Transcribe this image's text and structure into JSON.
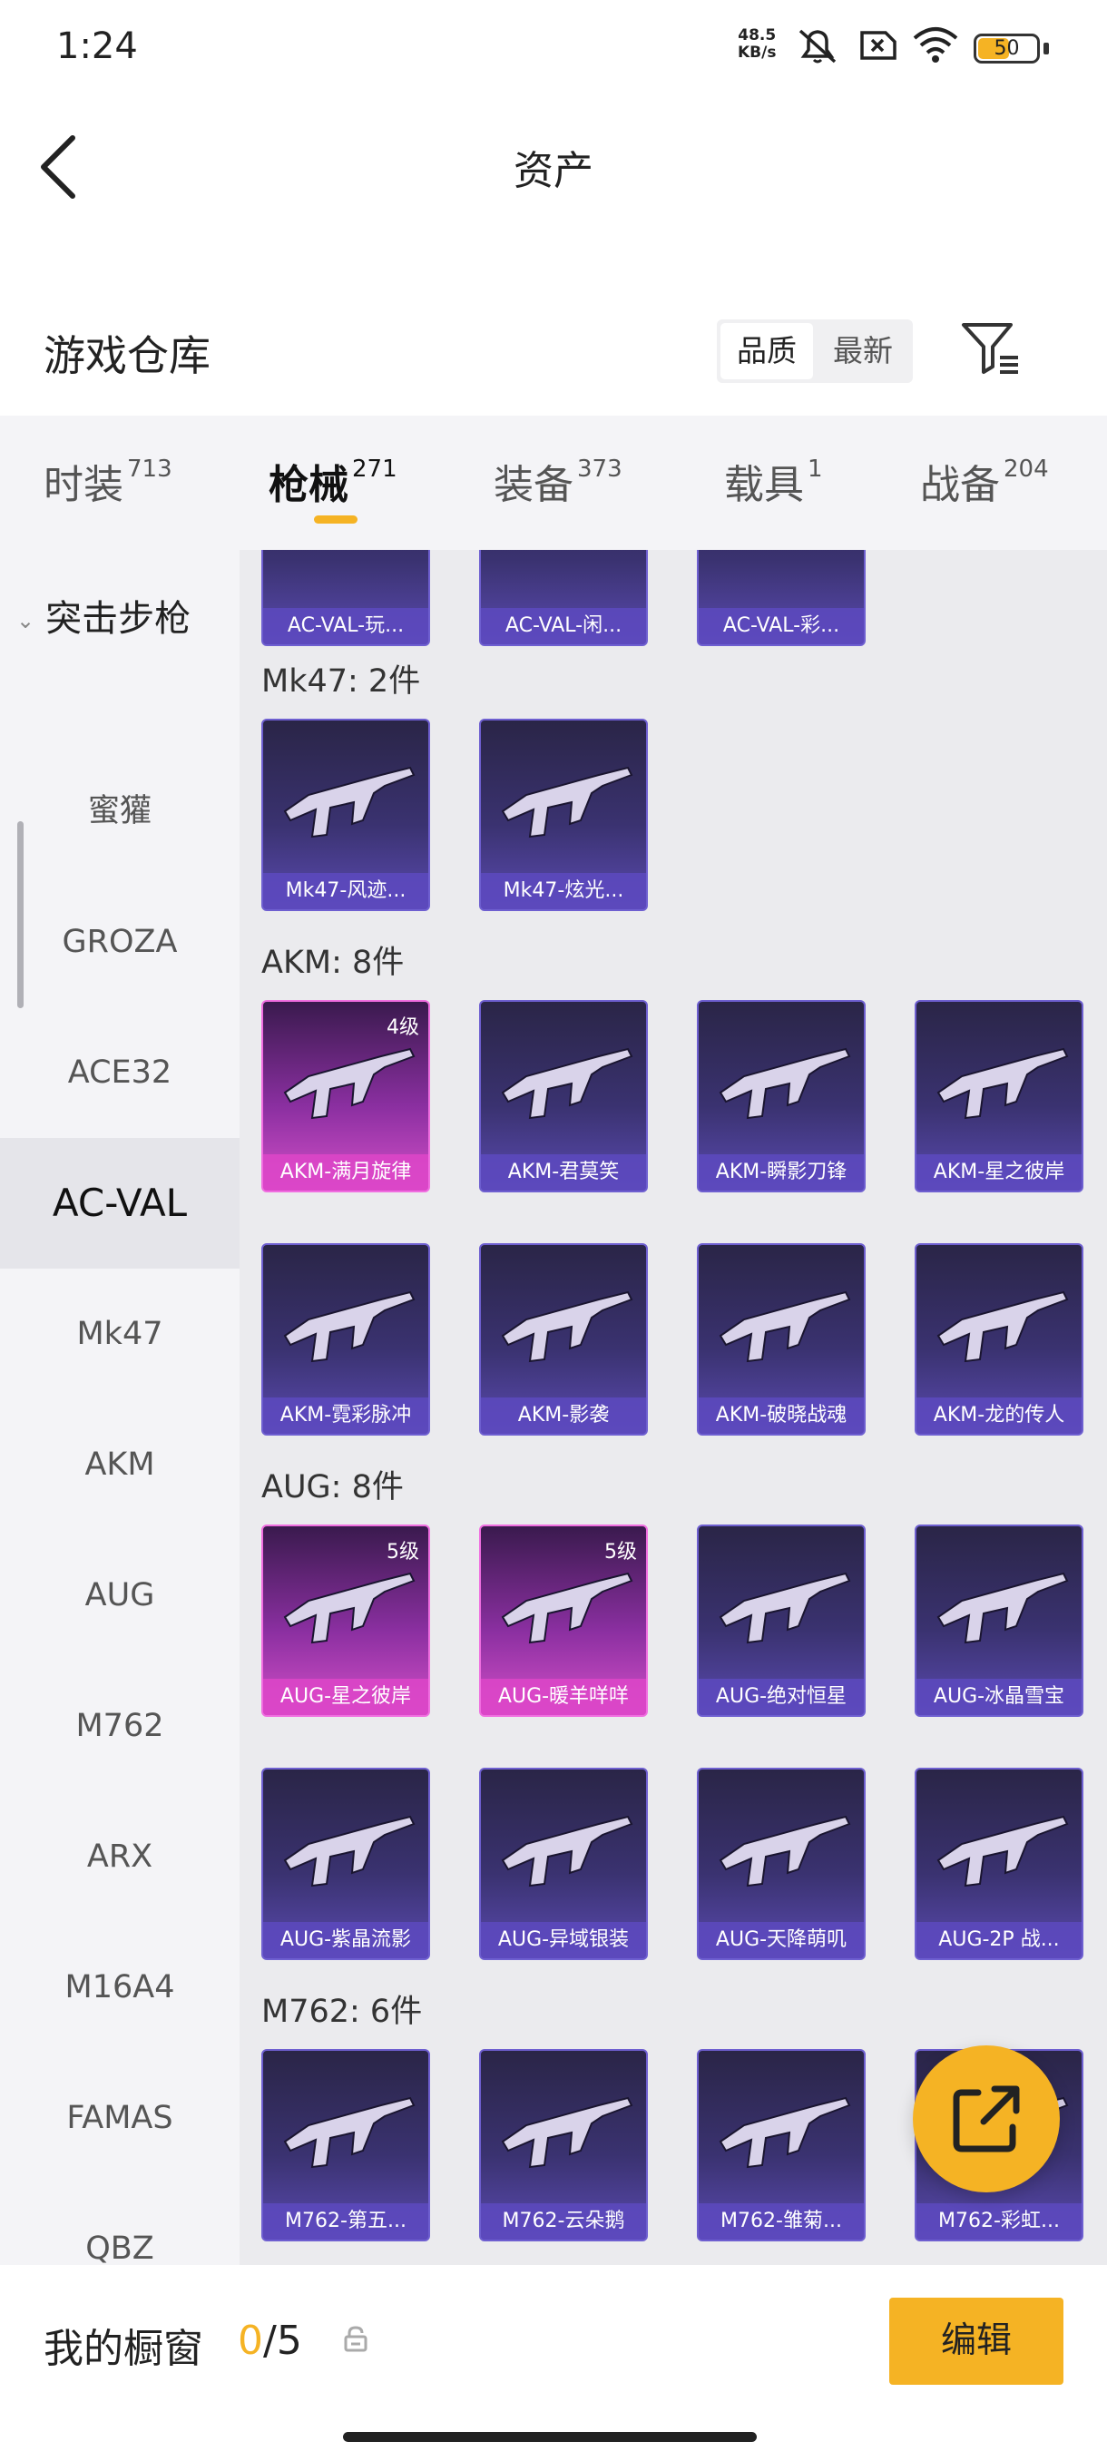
{
  "status": {
    "time": "1:24",
    "netspeed_value": "48.5",
    "netspeed_unit": "KB/s",
    "battery": "50"
  },
  "header": {
    "title": "资产"
  },
  "warehouse": {
    "title": "游戏仓库",
    "sort_quality": "品质",
    "sort_newest": "最新"
  },
  "tabs": [
    {
      "label": "时装",
      "count": "713"
    },
    {
      "label": "枪械",
      "count": "271"
    },
    {
      "label": "装备",
      "count": "373"
    },
    {
      "label": "载具",
      "count": "1"
    },
    {
      "label": "战备",
      "count": "204"
    }
  ],
  "sidebar": {
    "section": "突击步枪",
    "items": [
      "蜜獾",
      "GROZA",
      "ACE32",
      "AC-VAL",
      "Mk47",
      "AKM",
      "AUG",
      "M762",
      "ARX",
      "M16A4",
      "FAMAS",
      "QBZ"
    ],
    "active": "AC-VAL"
  },
  "groups": {
    "acval": {
      "items": [
        {
          "name": "AC-VAL-玩..."
        },
        {
          "name": "AC-VAL-闲..."
        },
        {
          "name": "AC-VAL-彩..."
        }
      ]
    },
    "mk47": {
      "header": "Mk47: 2件",
      "items": [
        {
          "name": "Mk47-风迹..."
        },
        {
          "name": "Mk47-炫光..."
        }
      ]
    },
    "akm": {
      "header": "AKM: 8件",
      "items": [
        {
          "name": "AKM-满月旋律",
          "level": "4级"
        },
        {
          "name": "AKM-君莫笑"
        },
        {
          "name": "AKM-瞬影刀锋"
        },
        {
          "name": "AKM-星之彼岸"
        },
        {
          "name": "AKM-霓彩脉冲"
        },
        {
          "name": "AKM-影袭"
        },
        {
          "name": "AKM-破晓战魂"
        },
        {
          "name": "AKM-龙的传人"
        }
      ]
    },
    "aug": {
      "header": "AUG: 8件",
      "items": [
        {
          "name": "AUG-星之彼岸",
          "level": "5级"
        },
        {
          "name": "AUG-暖羊咩咩",
          "level": "5级"
        },
        {
          "name": "AUG-绝对恒星"
        },
        {
          "name": "AUG-冰晶雪宝"
        },
        {
          "name": "AUG-紫晶流影"
        },
        {
          "name": "AUG-异域银装"
        },
        {
          "name": "AUG-天降萌叽"
        },
        {
          "name": "AUG-2P 战..."
        }
      ]
    },
    "m762": {
      "header": "M762: 6件",
      "items": [
        {
          "name": "M762-第五..."
        },
        {
          "name": "M762-云朵鹅"
        },
        {
          "name": "M762-雏菊..."
        },
        {
          "name": "M762-彩虹..."
        }
      ]
    }
  },
  "bottom": {
    "label": "我的橱窗",
    "current": "0",
    "separator": "/",
    "max": "5",
    "edit": "编辑"
  },
  "colors": {
    "accent": "#f5b324",
    "card": "#3a3270",
    "card_rare": "#c04bc0"
  }
}
